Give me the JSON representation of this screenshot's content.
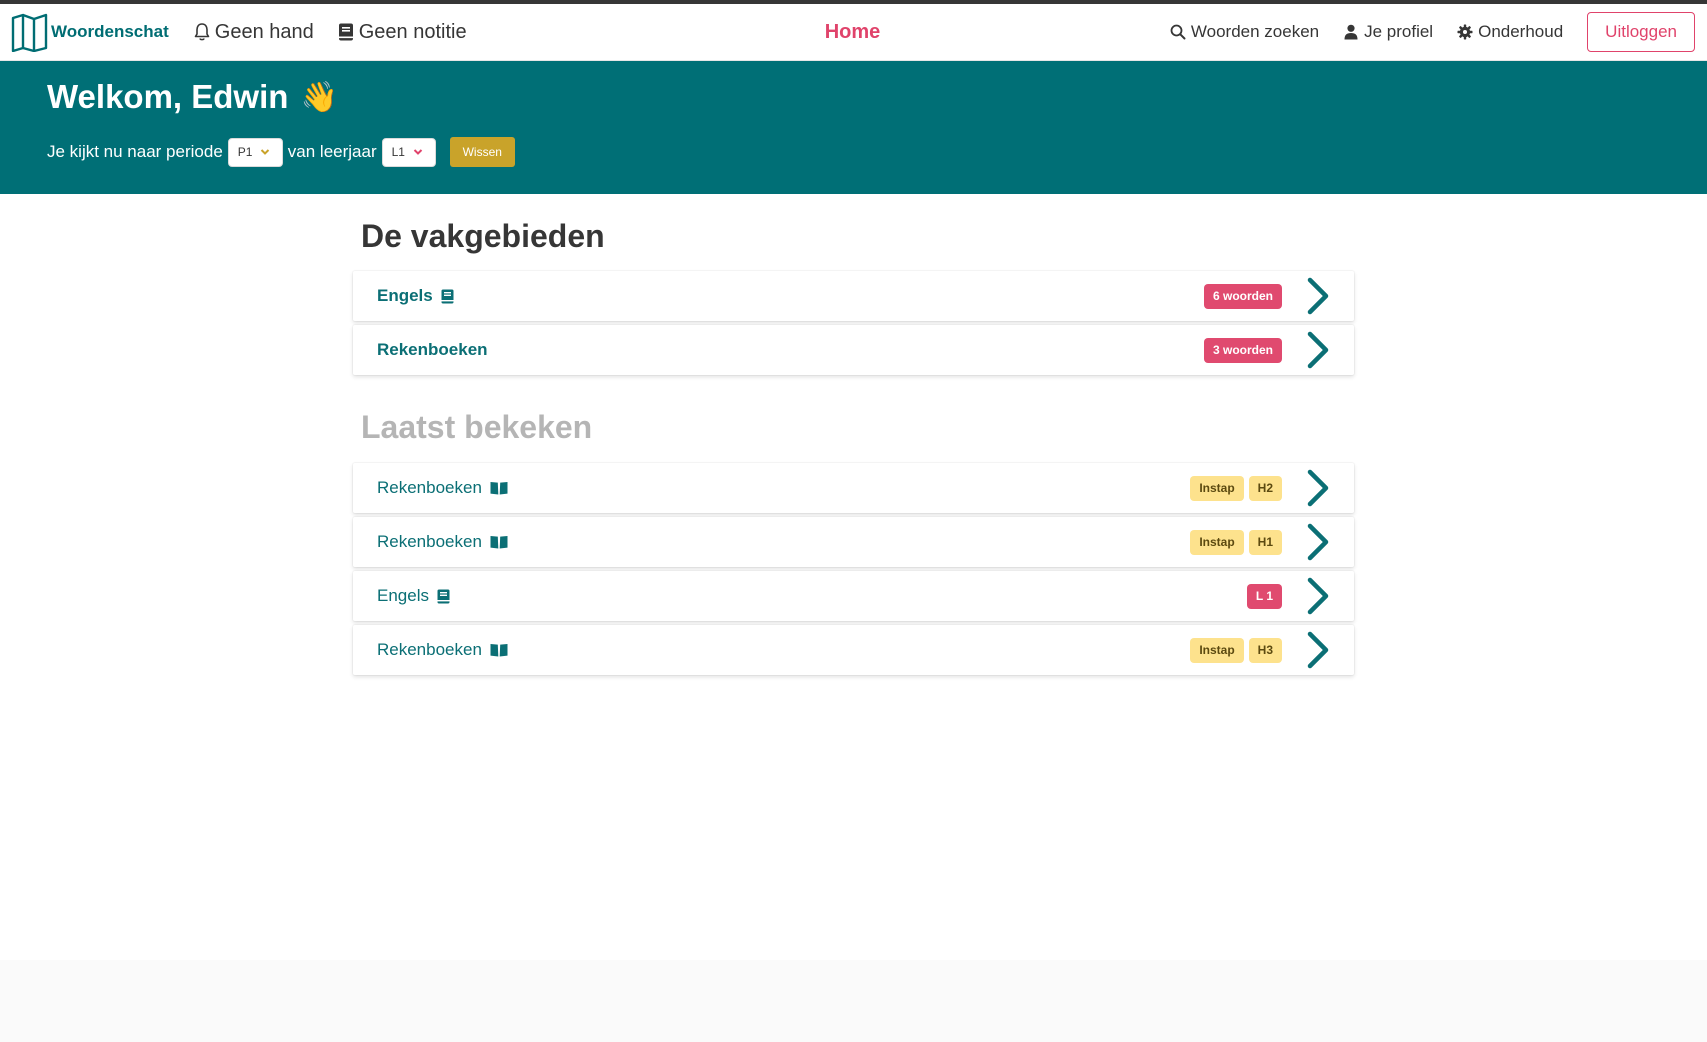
{
  "brand": {
    "name": "Woordenschat",
    "icon": "open-book-outline-icon"
  },
  "nav": {
    "left": [
      {
        "label": "Geen hand",
        "icon": "bell-icon"
      },
      {
        "label": "Geen notitie",
        "icon": "notebook-icon"
      }
    ],
    "center": {
      "label": "Home"
    },
    "right": [
      {
        "label": "Woorden zoeken",
        "icon": "search-icon"
      },
      {
        "label": "Je profiel",
        "icon": "user-icon"
      },
      {
        "label": "Onderhoud",
        "icon": "gear-icon"
      }
    ],
    "logout_label": "Uitloggen"
  },
  "hero": {
    "greeting": "Welkom, Edwin",
    "emoji": "👋",
    "period_text": "Je kijkt nu naar periode",
    "period_value": "P1",
    "year_text": "van leerjaar",
    "year_value": "L1",
    "clear_label": "Wissen"
  },
  "subjects": {
    "title": "De vakgebieden",
    "items": [
      {
        "label": "Engels",
        "icon": "book-icon",
        "badge": "6 woorden"
      },
      {
        "label": "Rekenboeken",
        "badge": "3 woorden"
      }
    ]
  },
  "recent": {
    "title": "Laatst bekeken",
    "items": [
      {
        "label": "Rekenboeken",
        "icon": "open-book-icon",
        "tags": [
          "Instap",
          "H2"
        ]
      },
      {
        "label": "Rekenboeken",
        "icon": "open-book-icon",
        "tags": [
          "Instap",
          "H1"
        ]
      },
      {
        "label": "Engels",
        "icon": "book-icon",
        "tags": [
          "L 1"
        ]
      },
      {
        "label": "Rekenboeken",
        "icon": "open-book-icon",
        "tags": [
          "Instap",
          "H3"
        ]
      }
    ]
  },
  "colors": {
    "primary": "#006f76",
    "accent": "#e0436b",
    "warning": "#fde28d",
    "wissen": "#c9a32a"
  }
}
